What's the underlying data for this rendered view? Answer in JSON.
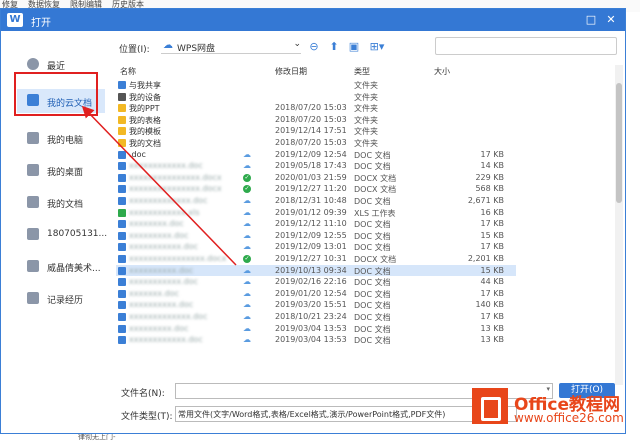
{
  "background": {
    "top_menu": [
      "修复",
      "数据恢复",
      "限制编辑",
      "历史版本"
    ],
    "bottom_text": "律彻无上门-"
  },
  "dialog": {
    "title": "打开",
    "logo": "W",
    "minimize_label": "□",
    "close_label": "✕"
  },
  "sidebar": {
    "items": [
      {
        "label": "最近",
        "icon": "clock-icon"
      },
      {
        "label": "我的云文档",
        "icon": "cloud-doc-icon",
        "active": true
      },
      {
        "label": "我的电脑",
        "icon": "computer-icon"
      },
      {
        "label": "我的桌面",
        "icon": "desktop-icon"
      },
      {
        "label": "我的文档",
        "icon": "folder-icon"
      },
      {
        "label": "180705131...",
        "icon": "folder-icon"
      },
      {
        "label": "威晶倩美术...",
        "icon": "folder-icon"
      },
      {
        "label": "记录经历",
        "icon": "folder-icon"
      }
    ]
  },
  "toolbar": {
    "location_label": "位置(I):",
    "location_value": "WPS网盘",
    "back_icon": "back-icon",
    "upfolder_icon": "folder-up-icon",
    "newfolder_icon": "new-folder-icon",
    "view_icon": "view-grid-icon",
    "search_placeholder": ""
  },
  "columns": {
    "name": "名称",
    "date": "修改日期",
    "type": "类型",
    "size": "大小"
  },
  "files": [
    {
      "name": "与我共享",
      "date": "",
      "type": "文件夹",
      "size": "",
      "icon": "share",
      "status": "",
      "blur": false
    },
    {
      "name": "我的设备",
      "date": "",
      "type": "文件夹",
      "size": "",
      "icon": "device",
      "status": "",
      "blur": false
    },
    {
      "name": "我的PPT",
      "date": "2018/07/20 15:03",
      "type": "文件夹",
      "size": "",
      "icon": "folder",
      "status": "",
      "blur": false
    },
    {
      "name": "我的表格",
      "date": "2018/07/20 15:03",
      "type": "文件夹",
      "size": "",
      "icon": "folder",
      "status": "",
      "blur": false
    },
    {
      "name": "我的模板",
      "date": "2019/12/14 17:51",
      "type": "文件夹",
      "size": "",
      "icon": "folder",
      "status": "",
      "blur": false
    },
    {
      "name": "我的文档",
      "date": "2018/07/20 15:03",
      "type": "文件夹",
      "size": "",
      "icon": "folder",
      "status": "",
      "blur": false
    },
    {
      "name": ".doc",
      "date": "2019/12/09 12:54",
      "type": "DOC 文档",
      "size": "17 KB",
      "icon": "doc",
      "status": "cloud",
      "blur": false
    },
    {
      "name": "xxxxxxxxxxxx.doc",
      "date": "2019/05/18 17:43",
      "type": "DOC 文档",
      "size": "14 KB",
      "icon": "doc",
      "status": "cloud",
      "blur": true
    },
    {
      "name": "xxxxxxxxxxxxxxx.docx",
      "date": "2020/01/03 21:59",
      "type": "DOCX 文档",
      "size": "229 KB",
      "icon": "doc",
      "status": "ok",
      "blur": true
    },
    {
      "name": "xxxxxxxxxxxxxxx.docx",
      "date": "2019/12/27 11:20",
      "type": "DOCX 文档",
      "size": "568 KB",
      "icon": "doc",
      "status": "ok",
      "blur": true
    },
    {
      "name": "xxxxxxxxxxxxx.doc",
      "date": "2018/12/31 10:48",
      "type": "DOC 文档",
      "size": "2,671 KB",
      "icon": "doc",
      "status": "cloud",
      "blur": true
    },
    {
      "name": "xxxxxxxxxxxx.xls",
      "date": "2019/01/12 09:39",
      "type": "XLS 工作表",
      "size": "16 KB",
      "icon": "xls",
      "status": "cloud",
      "blur": true
    },
    {
      "name": "xxxxxxxx.doc",
      "date": "2019/12/12 11:10",
      "type": "DOC 文档",
      "size": "17 KB",
      "icon": "doc",
      "status": "cloud",
      "blur": true
    },
    {
      "name": "xxxxxxxxx.doc",
      "date": "2019/12/09 12:55",
      "type": "DOC 文档",
      "size": "15 KB",
      "icon": "doc",
      "status": "cloud",
      "blur": true
    },
    {
      "name": "xxxxxxxxxxx.doc",
      "date": "2019/12/09 13:01",
      "type": "DOC 文档",
      "size": "17 KB",
      "icon": "doc",
      "status": "cloud",
      "blur": true
    },
    {
      "name": "xxxxxxxxxxxxxxxx.docx",
      "date": "2019/12/27 10:31",
      "type": "DOCX 文档",
      "size": "2,201 KB",
      "icon": "doc",
      "status": "ok",
      "blur": true
    },
    {
      "name": "xxxxxxxxxx.doc",
      "date": "2019/10/13 09:34",
      "type": "DOC 文档",
      "size": "15 KB",
      "icon": "doc",
      "status": "cloud",
      "blur": true,
      "selected": true
    },
    {
      "name": "xxxxxxxxxxx.doc",
      "date": "2019/02/16 22:16",
      "type": "DOC 文档",
      "size": "44 KB",
      "icon": "doc",
      "status": "cloud",
      "blur": true
    },
    {
      "name": "xxxxxxx.doc",
      "date": "2019/01/20 12:54",
      "type": "DOC 文档",
      "size": "17 KB",
      "icon": "doc",
      "status": "cloud",
      "blur": true
    },
    {
      "name": "xxxxxxxxxx.doc",
      "date": "2019/03/20 15:51",
      "type": "DOC 文档",
      "size": "140 KB",
      "icon": "doc",
      "status": "cloud",
      "blur": true
    },
    {
      "name": "xxxxxxxxxxxxx.doc",
      "date": "2018/10/21 23:24",
      "type": "DOC 文档",
      "size": "17 KB",
      "icon": "doc",
      "status": "cloud",
      "blur": true
    },
    {
      "name": "xxxxxxxxx.doc",
      "date": "2019/03/04 13:53",
      "type": "DOC 文档",
      "size": "13 KB",
      "icon": "doc",
      "status": "cloud",
      "blur": true
    },
    {
      "name": "xxxxxxxxxxxx.doc",
      "date": "2019/03/04 13:53",
      "type": "DOC 文档",
      "size": "13 KB",
      "icon": "doc",
      "status": "cloud",
      "blur": true
    }
  ],
  "footer": {
    "filename_label": "文件名(N):",
    "filename_value": "",
    "open_label": "打开(O)",
    "filetype_label": "文件类型(T):",
    "filetype_value": "常用文件(文字/Word格式,表格/Excel格式,演示/PowerPoint格式,PDF文件)"
  },
  "watermark": {
    "line1": "Office教程网",
    "line2": "www.office26.com"
  },
  "colors": {
    "accent": "#3478d4",
    "annotation": "#e02020",
    "brand_watermark": "#e8461a"
  }
}
